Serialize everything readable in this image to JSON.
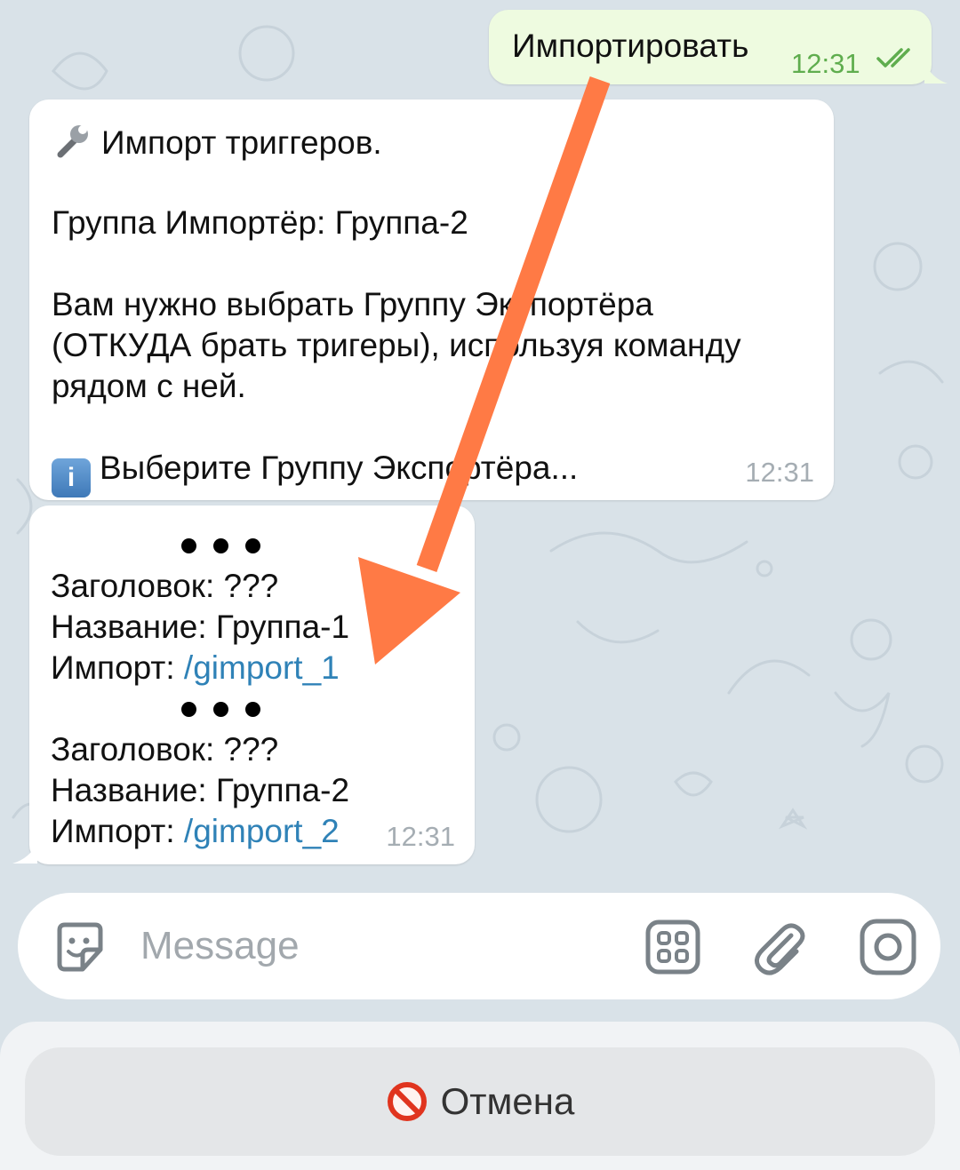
{
  "colors": {
    "chat_background": "#d9e2e8",
    "outgoing_bubble": "#eefbe0",
    "incoming_bubble": "#ffffff",
    "link": "#2f82b7",
    "outgoing_time": "#5fad4e",
    "incoming_time": "#a5adb3",
    "annotation_arrow": "#ff7a45"
  },
  "outgoing": {
    "text": "Импортировать",
    "time": "12:31",
    "status_icon": "double-check-icon"
  },
  "message1": {
    "title_emoji": "wrench-icon",
    "title": "Импорт триггеров.",
    "group_line": "Группа Импортёр: Группа-2",
    "instruction_lines": [
      "Вам нужно выбрать Группу Экспортёра",
      "(ОТКУДА брать тригеры), используя команду",
      "рядом с ней."
    ],
    "info_emoji": "info-icon",
    "info_text": "Выберите Группу Экспортёра...",
    "time": "12:31"
  },
  "message2": {
    "groups": [
      {
        "header_label": "Заголовок: ???",
        "name_label": "Название: Группа-1",
        "import_prefix": "Импорт: ",
        "import_command": "/gimport_1"
      },
      {
        "header_label": "Заголовок: ???",
        "name_label": "Название: Группа-2",
        "import_prefix": "Импорт: ",
        "import_command": "/gimport_2"
      }
    ],
    "time": "12:31"
  },
  "composer": {
    "placeholder": "Message",
    "icons": [
      "sticker-icon",
      "bot-menu-icon",
      "attach-icon",
      "camera-icon"
    ]
  },
  "keyboard": {
    "cancel_label": "Отмена",
    "cancel_emoji": "prohibited-icon"
  }
}
